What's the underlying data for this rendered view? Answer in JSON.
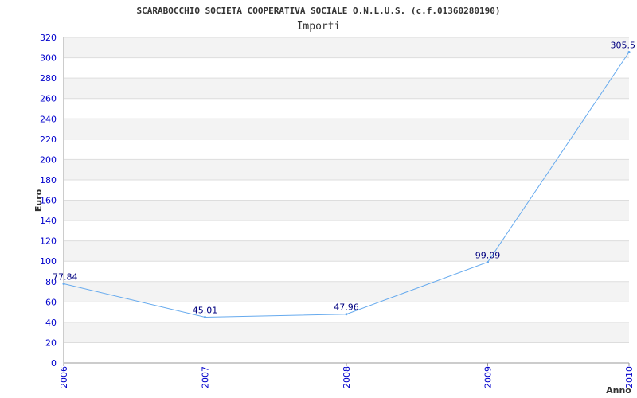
{
  "chart_data": {
    "type": "line",
    "title": "SCARABOCCHIO SOCIETA COOPERATIVA SOCIALE O.N.L.U.S. (c.f.01360280190)",
    "subtitle": "Importi",
    "xlabel": "Anno",
    "ylabel": "Euro",
    "categories": [
      "2006",
      "2007",
      "2008",
      "2009",
      "2010"
    ],
    "series": [
      {
        "values": [
          77.84,
          45.01,
          47.96,
          99.09,
          305.5
        ]
      }
    ],
    "data_labels": [
      "77.84",
      "45.01",
      "47.96",
      "99.09",
      "305.5"
    ],
    "ylim": [
      0,
      320
    ],
    "yticks": [
      "0",
      "20",
      "40",
      "60",
      "80",
      "100",
      "120",
      "140",
      "160",
      "180",
      "200",
      "220",
      "240",
      "260",
      "280",
      "300",
      "320"
    ],
    "grid": true,
    "line_color": "#66aaee"
  }
}
